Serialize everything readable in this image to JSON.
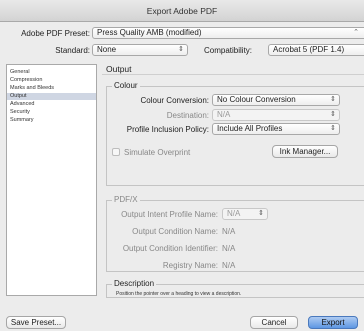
{
  "window": {
    "title": "Export Adobe PDF"
  },
  "preset": {
    "label": "Adobe PDF Preset:",
    "value": "Press Quality AMB (modified)"
  },
  "standard": {
    "label": "Standard:",
    "value": "None"
  },
  "compatibility": {
    "label": "Compatibility:",
    "value": "Acrobat 5 (PDF 1.4)"
  },
  "sidebar": {
    "items": [
      {
        "label": "General"
      },
      {
        "label": "Compression"
      },
      {
        "label": "Marks and Bleeds"
      },
      {
        "label": "Output"
      },
      {
        "label": "Advanced"
      },
      {
        "label": "Security"
      },
      {
        "label": "Summary"
      }
    ],
    "selected": "Output"
  },
  "panel": {
    "heading": "Output"
  },
  "colour": {
    "title": "Colour",
    "conversion": {
      "label": "Colour Conversion:",
      "value": "No Colour Conversion"
    },
    "destination": {
      "label": "Destination:",
      "value": "N/A"
    },
    "profile_policy": {
      "label": "Profile Inclusion Policy:",
      "value": "Include All Profiles"
    },
    "simulate_overprint": {
      "label": "Simulate Overprint",
      "checked": false
    },
    "ink_manager": {
      "label": "Ink Manager..."
    }
  },
  "pdfx": {
    "title": "PDF/X",
    "output_intent": {
      "label": "Output Intent Profile Name:",
      "value": "N/A"
    },
    "condition_name": {
      "label": "Output Condition Name:",
      "value": "N/A"
    },
    "condition_identifier": {
      "label": "Output Condition Identifier:",
      "value": "N/A"
    },
    "registry_name": {
      "label": "Registry Name:",
      "value": "N/A"
    }
  },
  "description": {
    "title": "Description",
    "text": "Position the pointer over a heading to view a description."
  },
  "buttons": {
    "save_preset": "Save Preset...",
    "cancel": "Cancel",
    "export": "Export"
  }
}
